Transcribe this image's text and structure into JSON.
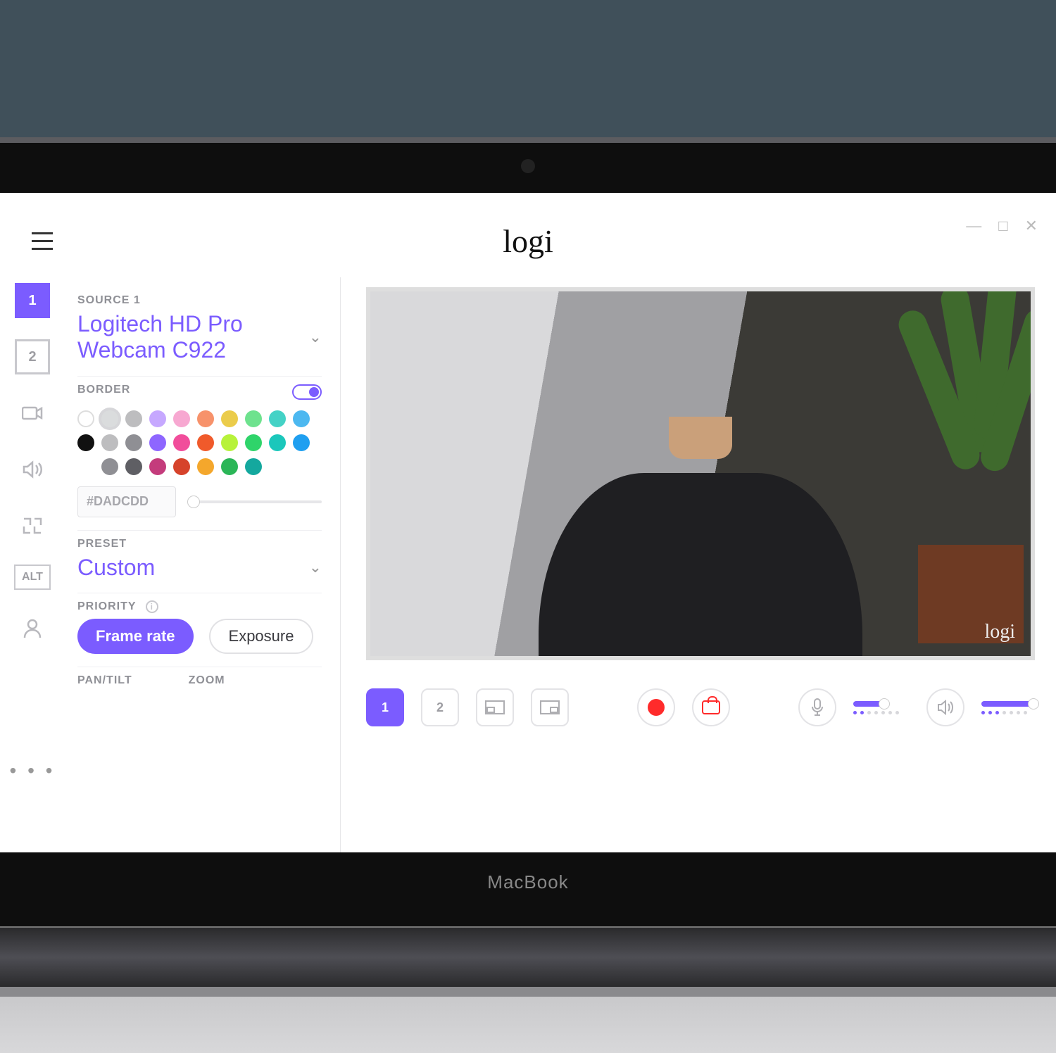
{
  "app": {
    "brand": "logi"
  },
  "window_controls": {
    "minimize": "—",
    "maximize": "□",
    "close": "✕"
  },
  "rail": {
    "source1": "1",
    "source2": "2",
    "alt": "ALT",
    "more": "• • •"
  },
  "panel": {
    "source": {
      "label": "SOURCE 1",
      "value": "Logitech HD Pro Webcam C922"
    },
    "border": {
      "label": "BORDER",
      "toggle_on": true,
      "hex": "#DADCDD",
      "swatches": [
        [
          "#FFFFFF",
          "#DADCDD",
          "#BDBDBF",
          "#C6A8FF",
          "#F7A8D1",
          "#F7926B",
          "#EBCC4B",
          "#6EE28E",
          "#44D2C6",
          "#4CB8F0"
        ],
        [
          "#111111",
          "#BDBDBF",
          "#8F8F94",
          "#8E66FF",
          "#F14D9B",
          "#F05A2B",
          "#B7F23A",
          "#2FD46A",
          "#1BC7BB",
          "#1F9FF0"
        ],
        [
          "",
          "#8F8F94",
          "#5F5F64",
          "#C43C7C",
          "#D6432B",
          "#F4A72C",
          "#2BB657",
          "#14A89E",
          "",
          ""
        ]
      ],
      "selected": "#DADCDD"
    },
    "preset": {
      "label": "PRESET",
      "value": "Custom"
    },
    "priority": {
      "label": "PRIORITY",
      "frame_rate": "Frame rate",
      "exposure": "Exposure",
      "active": "frame_rate"
    },
    "pantilt": {
      "pan_label": "PAN/TILT",
      "zoom_label": "ZOOM"
    }
  },
  "preview": {
    "watermark": "logi"
  },
  "bottombar": {
    "source1": "1",
    "source2": "2"
  },
  "macbook": {
    "label": "MacBook"
  }
}
